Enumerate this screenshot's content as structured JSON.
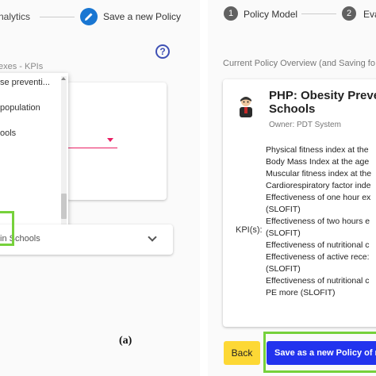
{
  "left_panel": {
    "stepper": {
      "step1_label": "nalytics",
      "step2_label": "Save a new Policy",
      "step2_icon": "pencil-icon"
    },
    "help_icon": "?",
    "kpi_field_label": "exes - KPIs",
    "dropdown_options": [
      "se preventi...",
      "population",
      "ools"
    ],
    "expansion_text": "in Schools",
    "caption": "(a)"
  },
  "right_panel": {
    "stepper": {
      "step1_number": "1",
      "step1_label": "Policy Model",
      "step2_number": "2",
      "step2_label": "Eva"
    },
    "overview_title": "Current Policy Overview (and Saving fo",
    "policy": {
      "title_line1": "PHP: Obesity Preve",
      "title_line2": "Schools",
      "owner": "Owner: PDT System",
      "kpis_label": "KPI(s):",
      "kpis": [
        "Physical fitness index at the",
        "Body Mass Index at the age",
        "Muscular fitness index at the",
        "Cardiorespiratory factor inde",
        "Effectiveness of one hour ex",
        "(SLOFIT)",
        "Effectiveness of two hours e",
        "(SLOFIT)",
        "Effectiveness of nutritional c",
        "Effectiveness of active rece:",
        "(SLOFIT)",
        "Effectiveness of nutritional c",
        "PE more (SLOFIT)"
      ]
    },
    "buttons": {
      "back": "Back",
      "save": "Save as a new Policy of m"
    }
  },
  "colors": {
    "accent_blue": "#1976d2",
    "save_button": "#2233ee",
    "back_button": "#fdd835",
    "highlight_green": "#76d13b",
    "select_pink": "#e91e63"
  }
}
